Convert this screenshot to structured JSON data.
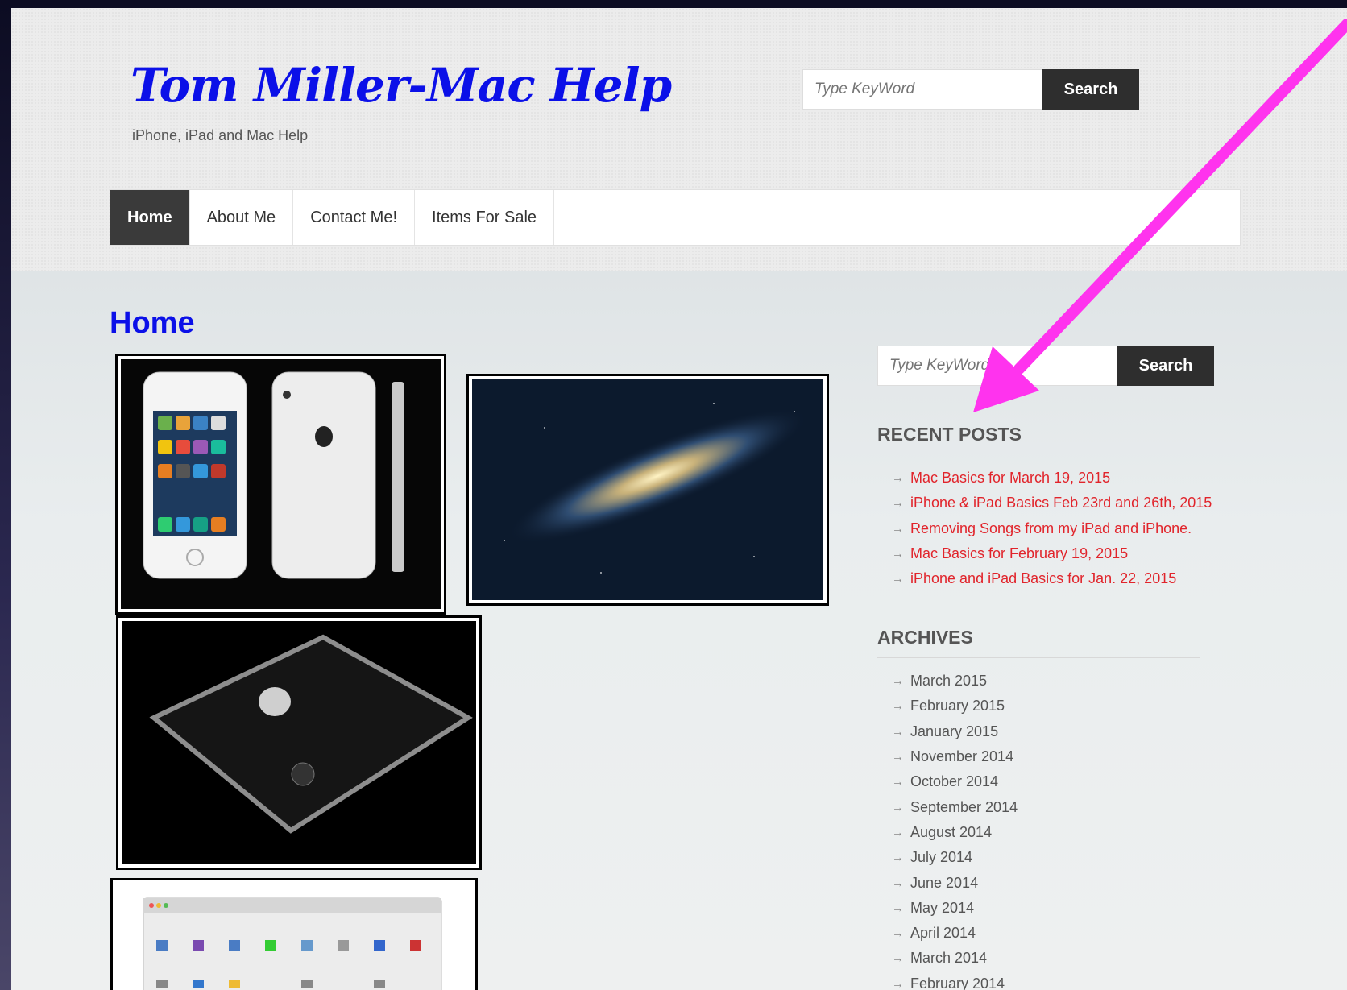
{
  "site": {
    "title": "Tom Miller-Mac Help",
    "tagline": "iPhone, iPad and Mac Help"
  },
  "header_search": {
    "placeholder": "Type KeyWord",
    "button": "Search"
  },
  "nav": {
    "items": [
      "Home",
      "About Me",
      "Contact Me!",
      "Items For Sale"
    ],
    "active": "Home"
  },
  "main": {
    "title": "Home"
  },
  "sidebar": {
    "search": {
      "placeholder": "Type KeyWord",
      "button": "Search"
    },
    "recent_posts": {
      "title": "RECENT POSTS",
      "items": [
        "Mac Basics for March 19, 2015",
        "iPhone & iPad Basics Feb 23rd and 26th, 2015",
        "Removing Songs from my iPad and iPhone.",
        "Mac Basics for February 19, 2015",
        "iPhone and iPad Basics for Jan. 22, 2015"
      ]
    },
    "archives": {
      "title": "ARCHIVES",
      "items": [
        "March 2015",
        "February 2015",
        "January 2015",
        "November 2014",
        "October 2014",
        "September 2014",
        "August 2014",
        "July 2014",
        "June 2014",
        "May 2014",
        "April 2014",
        "March 2014",
        "February 2014"
      ]
    }
  },
  "colors": {
    "title": "#0b10e8",
    "link": "#e1242b",
    "annotation_arrow": "#ff33ee"
  }
}
